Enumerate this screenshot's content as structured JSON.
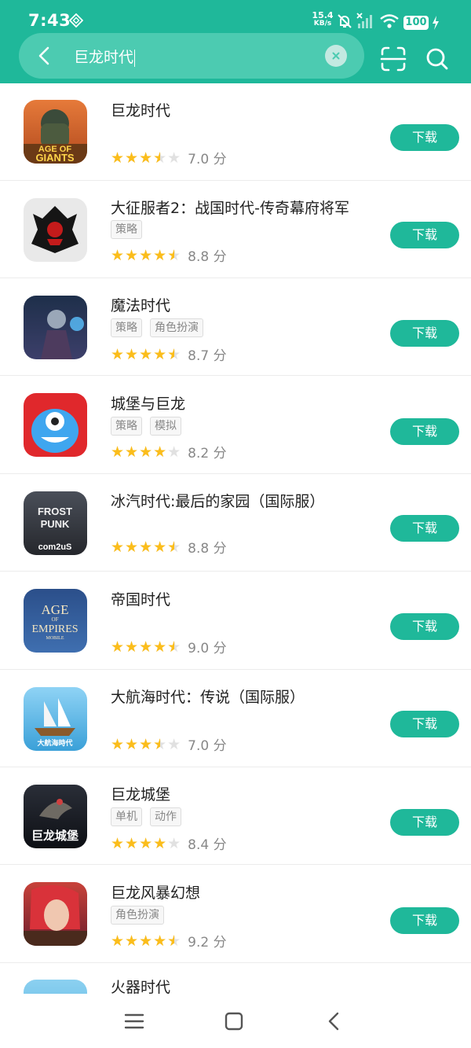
{
  "status_bar": {
    "time": "7:43",
    "net_speed_value": "15.4",
    "net_speed_unit": "KB/s",
    "battery": "100"
  },
  "search": {
    "query": "巨龙时代"
  },
  "colors": {
    "accent": "#1fb89a",
    "star": "#fbbd1b"
  },
  "apps": [
    {
      "name": "巨龙时代",
      "tags": [],
      "rating": 3.5,
      "score": "7.0 分",
      "button": "下载",
      "icon": "age-of-giants-icon"
    },
    {
      "name": "大征服者2：战国时代-传奇幕府将军",
      "tags": [
        "策略"
      ],
      "rating": 4.5,
      "score": "8.8 分",
      "button": "下载",
      "icon": "samurai-helmet-icon"
    },
    {
      "name": "魔法时代",
      "tags": [
        "策略",
        "角色扮演"
      ],
      "rating": 4.5,
      "score": "8.7 分",
      "button": "下载",
      "icon": "mage-icon"
    },
    {
      "name": "城堡与巨龙",
      "tags": [
        "策略",
        "模拟"
      ],
      "rating": 4,
      "score": "8.2 分",
      "button": "下载",
      "icon": "blue-monster-icon"
    },
    {
      "name": "冰汽时代:最后的家园（国际服）",
      "tags": [],
      "rating": 4.5,
      "score": "8.8 分",
      "button": "下载",
      "icon": "frostpunk-icon",
      "icon_text": [
        "FROST",
        "PUNK",
        "com2uS"
      ]
    },
    {
      "name": "帝国时代",
      "tags": [],
      "rating": 4.5,
      "score": "9.0 分",
      "button": "下载",
      "icon": "age-of-empires-icon",
      "icon_text": [
        "AGE",
        "OF",
        "EMPIRES",
        "MOBILE"
      ]
    },
    {
      "name": "大航海时代：传说（国际服）",
      "tags": [],
      "rating": 3.5,
      "score": "7.0 分",
      "button": "下载",
      "icon": "sailing-ship-icon",
      "icon_text": [
        "大航海時代"
      ]
    },
    {
      "name": "巨龙城堡",
      "tags": [
        "单机",
        "动作"
      ],
      "rating": 4,
      "score": "8.4 分",
      "button": "下载",
      "icon": "dragon-castle-icon",
      "icon_text": [
        "巨龙城堡"
      ]
    },
    {
      "name": "巨龙风暴幻想",
      "tags": [
        "角色扮演"
      ],
      "rating": 4.5,
      "score": "9.2 分",
      "button": "下载",
      "icon": "elf-warrior-icon"
    },
    {
      "name": "火器时代",
      "tags": [],
      "rating": null,
      "score": "",
      "button": "",
      "icon": "firearms-icon"
    }
  ],
  "nav": {
    "items": [
      "menu-icon",
      "home-icon",
      "back-icon"
    ]
  }
}
